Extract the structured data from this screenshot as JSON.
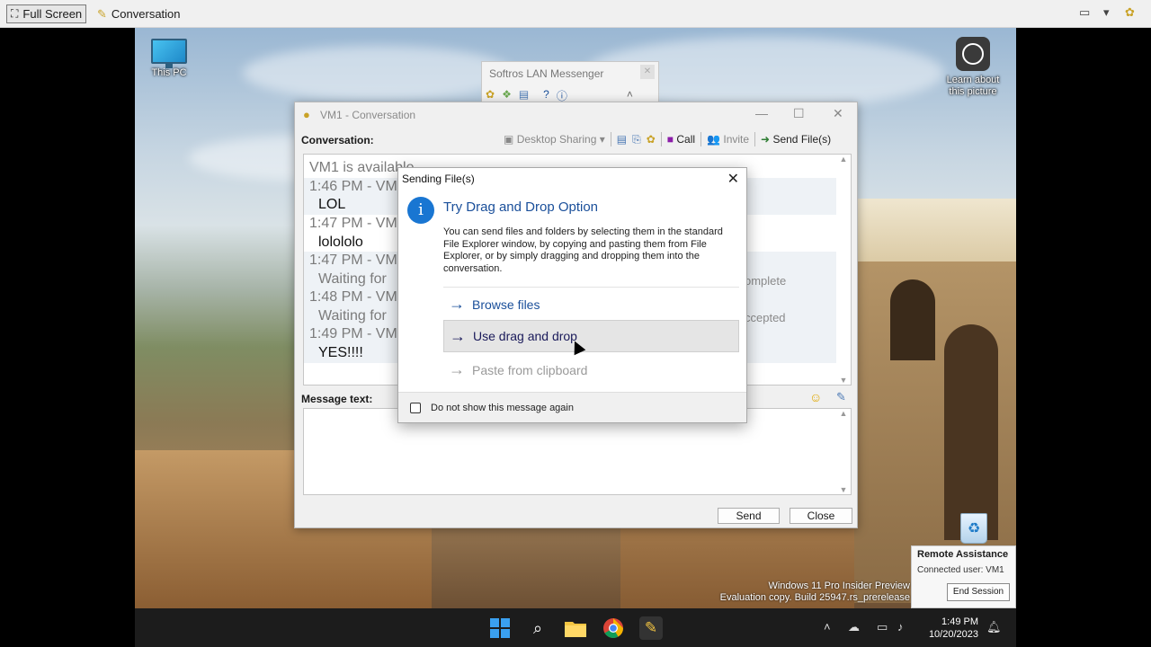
{
  "host_toolbar": {
    "full_screen_label": "Full Screen",
    "conversation_label": "Conversation"
  },
  "desktop": {
    "this_pc_label": "This PC",
    "learn_label_line1": "Learn about",
    "learn_label_line2": "this picture",
    "watermark_line1": "Windows 11 Pro Insider Preview",
    "watermark_line2": "Evaluation copy. Build 25947.rs_prerelease"
  },
  "messenger": {
    "title": "Softros LAN Messenger"
  },
  "conversation_window": {
    "title": "VM1 - Conversation",
    "conversation_label": "Conversation:",
    "toolbar": {
      "desktop_sharing": "Desktop Sharing",
      "call": "Call",
      "invite": "Invite",
      "send_files": "Send File(s)"
    },
    "lines": [
      {
        "text": "VM1 is available",
        "style": "gray"
      },
      {
        "text": "1:46 PM - VM",
        "style": "gray"
      },
      {
        "text": "LOL",
        "style": "bold"
      },
      {
        "text": "1:47 PM - VM",
        "style": "gray"
      },
      {
        "text": "lolololo",
        "style": "bold"
      },
      {
        "text": "1:47 PM - VM",
        "style": "gray"
      },
      {
        "text": "Waiting for",
        "style": "ind"
      },
      {
        "text": "1:48 PM - VM",
        "style": "gray"
      },
      {
        "text": "Waiting for",
        "style": "ind"
      },
      {
        "text": "1:49 PM - VM",
        "style": "gray"
      },
      {
        "text": "YES!!!!",
        "style": "bold"
      }
    ],
    "right_notes": [
      "omplete",
      "ccepted"
    ],
    "message_label": "Message text:",
    "send_label": "Send",
    "close_label": "Close"
  },
  "dialog": {
    "title": "Sending File(s)",
    "heading": "Try Drag and Drop Option",
    "body": "You can send files and folders by selecting them in the standard File Explorer window, by copying and pasting them from File Explorer, or by simply dragging and dropping them into the conversation.",
    "options": {
      "browse": "Browse files",
      "drag": "Use drag and drop",
      "paste": "Paste from clipboard"
    },
    "checkbox_label": "Do not show this message again",
    "checkbox_checked": false
  },
  "remote_assistance": {
    "title": "Remote Assistance",
    "user": "Connected user: VM1",
    "end_session": "End Session"
  },
  "taskbar": {
    "time": "1:49 PM",
    "date": "10/20/2023"
  }
}
